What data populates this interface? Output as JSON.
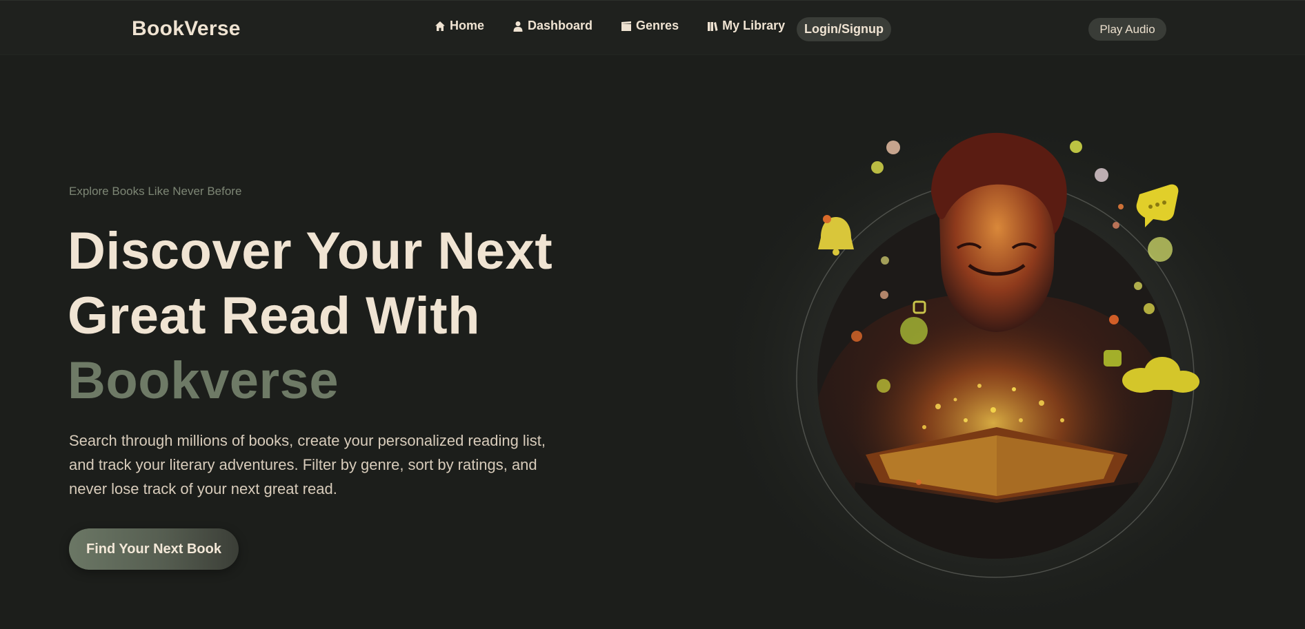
{
  "brand": "BookVerse",
  "nav": {
    "items": [
      {
        "label": "Home",
        "icon": "home-icon"
      },
      {
        "label": "Dashboard",
        "icon": "user-icon"
      },
      {
        "label": "Genres",
        "icon": "film-icon"
      },
      {
        "label": "My Library",
        "icon": "books-icon"
      }
    ],
    "login_label": "Login/Signup",
    "audio_label": "Play Audio"
  },
  "hero": {
    "eyebrow": "Explore Books Like Never Before",
    "headline_line1": "Discover Your Next",
    "headline_line2": "Great Read With",
    "headline_accent": "Bookverse",
    "description": "Search through millions of books, create your personalized reading list, and track your literary adventures. Filter by genre, sort by ratings, and never lose track of your next great read.",
    "cta_label": "Find Your Next Book"
  },
  "colors": {
    "background": "#1c1e1b",
    "navbar": "#1f211e",
    "text": "#f0e4d3",
    "accent": "#6e7a66",
    "muted": "#7d8675",
    "button": "#3a3d38"
  }
}
